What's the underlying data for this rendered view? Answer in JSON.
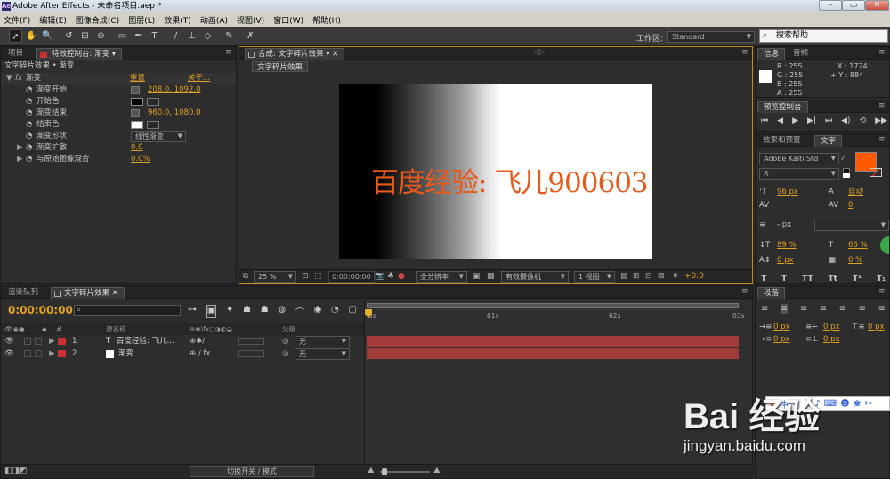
{
  "window": {
    "title": "Adobe After Effects - 未命名项目.aep *",
    "app_icon": "Ae"
  },
  "menu": [
    "文件(F)",
    "编辑(E)",
    "图像合成(C)",
    "图层(L)",
    "效果(T)",
    "动画(A)",
    "视图(V)",
    "窗口(W)",
    "帮助(H)"
  ],
  "toolbar": {
    "workspace_label": "工作区:",
    "workspace_value": "Standard",
    "search_help": "搜索帮助"
  },
  "project_panel": {
    "tab_project": "项目",
    "tab_effects": "特效控制台: 渐变",
    "subtitle": "文字碎片效果 • 渐变",
    "effect_name": "渐变",
    "reset": "重置",
    "about": "关于...",
    "props": [
      {
        "label": "渐变开始",
        "value": "208.0, 1092.0",
        "kind": "point"
      },
      {
        "label": "开始色",
        "value": "",
        "kind": "color",
        "color": "#000000"
      },
      {
        "label": "渐变结束",
        "value": "960.0, 1080.0",
        "kind": "point"
      },
      {
        "label": "结束色",
        "value": "",
        "kind": "color",
        "color": "#ffffff"
      },
      {
        "label": "渐变形状",
        "value": "线性渐变",
        "kind": "select"
      },
      {
        "label": "渐变扩散",
        "value": "0.0",
        "kind": "num"
      },
      {
        "label": "与原始图像混合",
        "value": "0.0%",
        "kind": "num"
      }
    ]
  },
  "comp_panel": {
    "tab": "合成: 文字碎片效果",
    "subtab": "文字碎片效果",
    "canvas_text": "百度经验: 飞儿900603",
    "canvas_text_color": "#e85a1a",
    "footer": {
      "zoom": "25 %",
      "timecode": "0:00:00:00",
      "resolution": "全分辨率",
      "camera": "有效摄像机",
      "views": "1 视图",
      "exposure": "+0.0"
    }
  },
  "info_panel": {
    "tab_info": "信息",
    "tab_audio": "音频",
    "r": "R : 255",
    "g": "G : 255",
    "b": "B : 255",
    "a": "A : 255",
    "x": "X : 1724",
    "y": "+ Y : 884"
  },
  "preview_panel": {
    "tab": "预览控制台"
  },
  "char_panel": {
    "tab_effects": "效果和预置",
    "tab_text": "文字",
    "font": "Adobe Kaiti Std",
    "style": "R",
    "size": "96 px",
    "leading": "自动",
    "tracking": "0",
    "stroke": "- px",
    "vscale": "89 %",
    "hscale": "66 %",
    "baseline": "0 px",
    "tsume": "0 %",
    "fill_color": "#ff5a00"
  },
  "paragraph_panel": {
    "tab": "段落",
    "indent_left": "0 px",
    "indent_right": "0 px",
    "space_before": "0 px",
    "first_indent": "0 px",
    "space_after": "0 px"
  },
  "timeline": {
    "tab_render": "渲染队列",
    "tab_comp": "文字碎片效果",
    "timecode": "0:00:00:00",
    "col_source": "源名称",
    "col_parent": "父级",
    "layers": [
      {
        "num": "1",
        "name": "百度经验: 飞儿...",
        "parent": "无",
        "label_color": "#c83232"
      },
      {
        "num": "2",
        "name": "渐变",
        "parent": "无",
        "label_color": "#c83232"
      }
    ],
    "ruler": [
      "0s",
      "01s",
      "02s",
      "03s"
    ],
    "toggle_mode": "切换开关 / 模式"
  },
  "watermark": {
    "brand": "Bai 经验",
    "url": "jingyan.baidu.com",
    "ime": "中"
  },
  "colors": {
    "accent": "#e0a020",
    "layer_bar": "#a23a3a"
  }
}
